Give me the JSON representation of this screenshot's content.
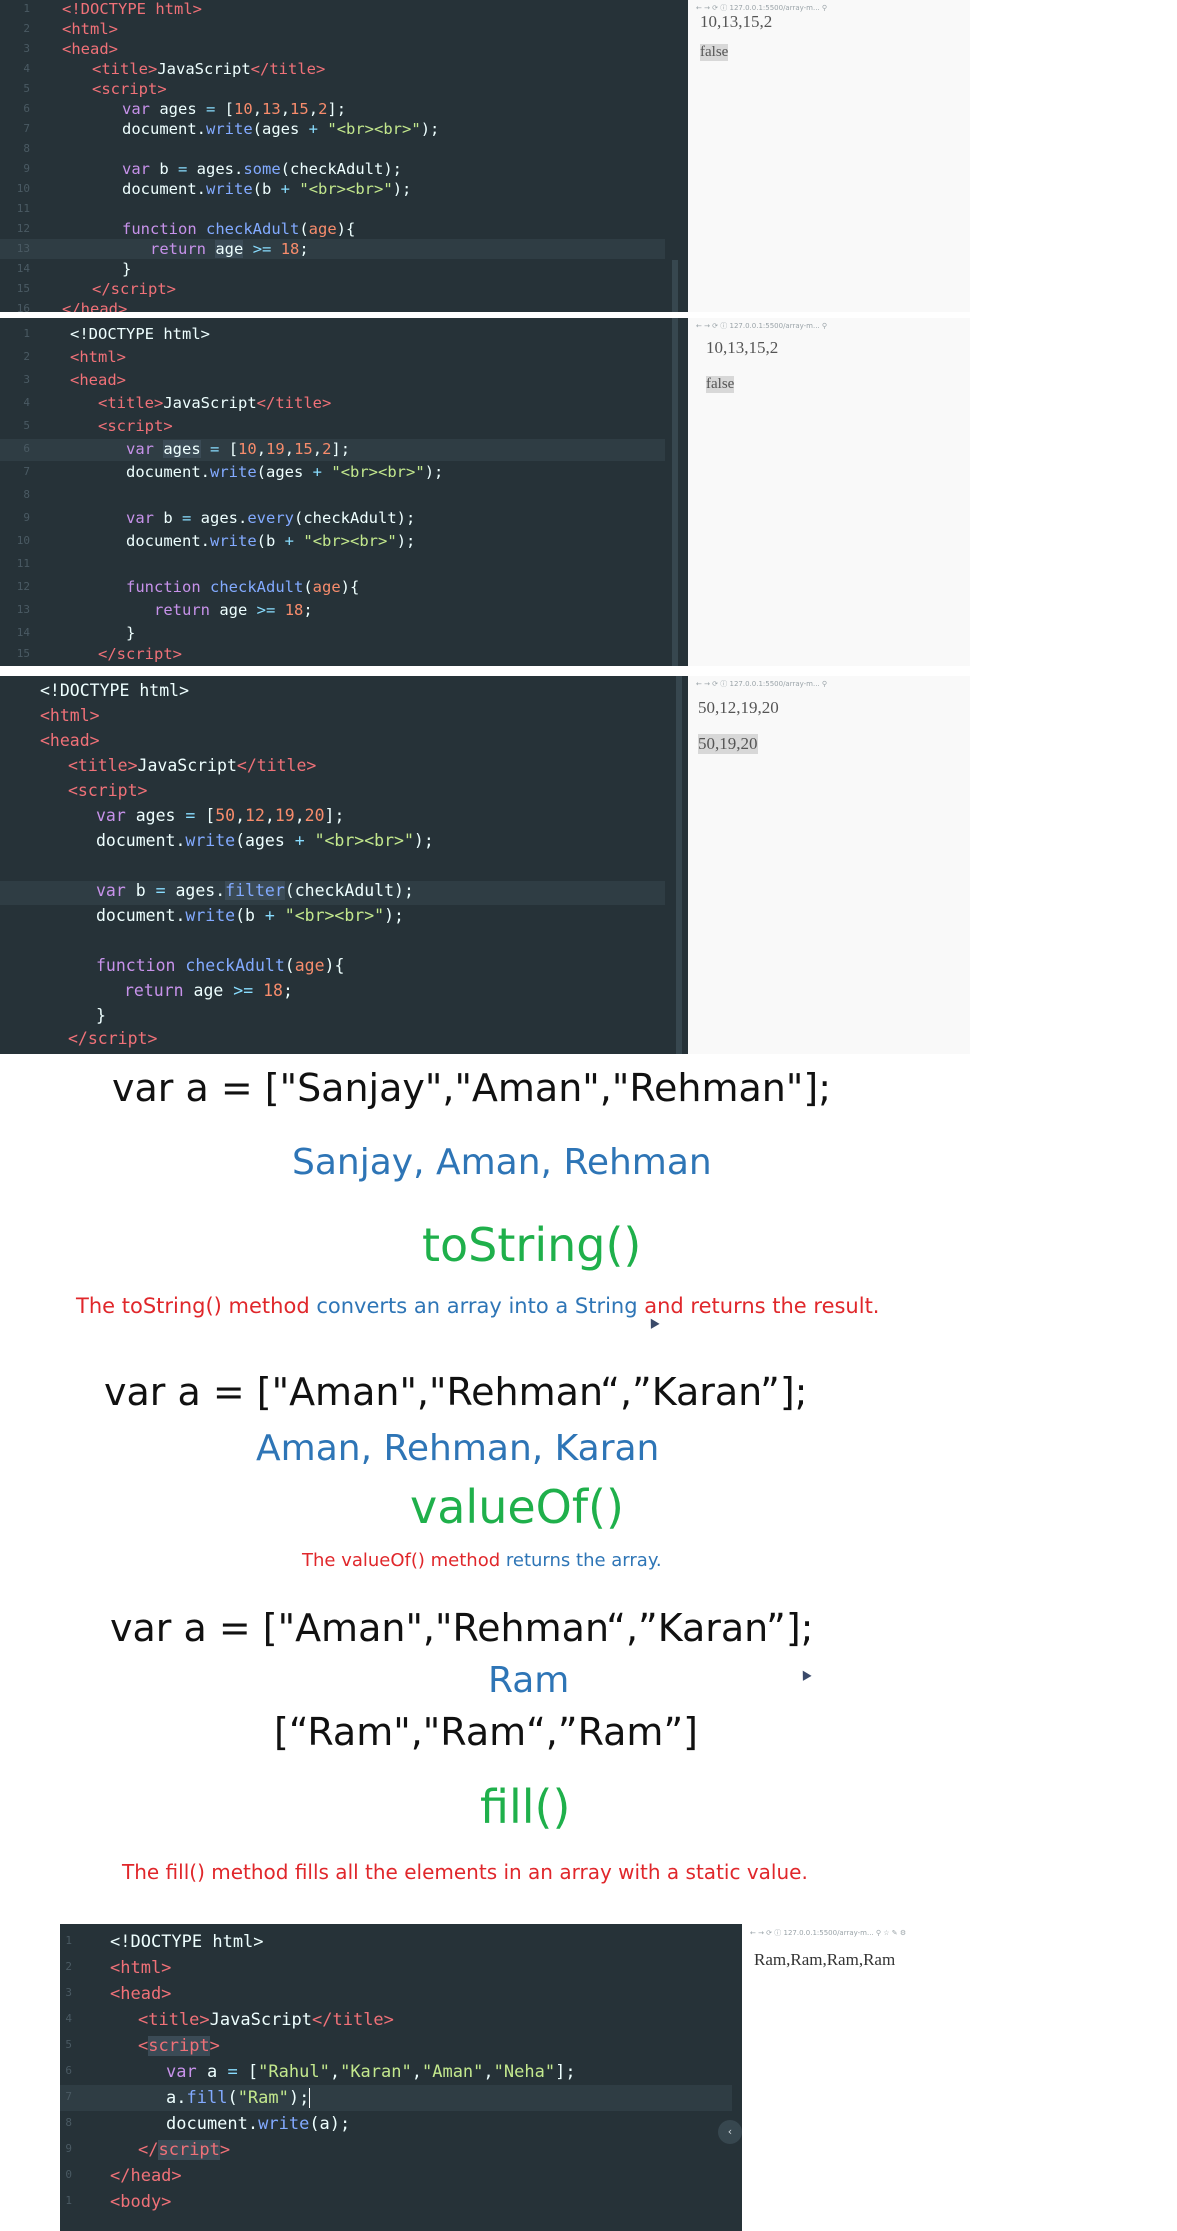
{
  "panel1": {
    "line_numbers": [
      "1",
      "2",
      "3",
      "4",
      "5",
      "6",
      "7",
      "8",
      "9",
      "10",
      "11",
      "12",
      "13",
      "14",
      "15",
      "16"
    ],
    "output_line1": "10,13,15,2",
    "output_line2": "false"
  },
  "panel2": {
    "line_numbers": [
      "1",
      "2",
      "3",
      "4",
      "5",
      "6",
      "7",
      "8",
      "9",
      "10",
      "11",
      "12",
      "13",
      "14",
      "15"
    ],
    "output_line1": "10,13,15,2",
    "output_line2": "false"
  },
  "panel3": {
    "output_line1": "50,12,19,20",
    "output_line2": "50,19,20"
  },
  "slide_tostring": {
    "code": "var a = [\"Sanjay\",\"Aman\",\"Rehman\"];",
    "result": "Sanjay, Aman, Rehman",
    "method": "toString()",
    "desc_red1": "The toString() method ",
    "desc_blue": "converts an array into a String ",
    "desc_red2": "and returns the result."
  },
  "slide_valueof": {
    "code": "var a = [\"Aman\",\"Rehman“,”Karan”];",
    "result": "Aman, Rehman, Karan",
    "method": "valueOf()",
    "desc_red": "The valueOf() method ",
    "desc_blue": "returns the array."
  },
  "slide_fill": {
    "code": "var a = [\"Aman\",\"Rehman“,”Karan”];",
    "value": "Ram",
    "result": "[“Ram\",\"Ram“,”Ram”]",
    "method": "fill()",
    "desc": "The fill() method fills all the elements in an array with a static value."
  },
  "panel4": {
    "line_numbers": [
      "1",
      "2",
      "3",
      "4",
      "5",
      "6",
      "7",
      "8",
      "9",
      "0",
      "1"
    ],
    "output": "Ram,Ram,Ram,Ram"
  }
}
